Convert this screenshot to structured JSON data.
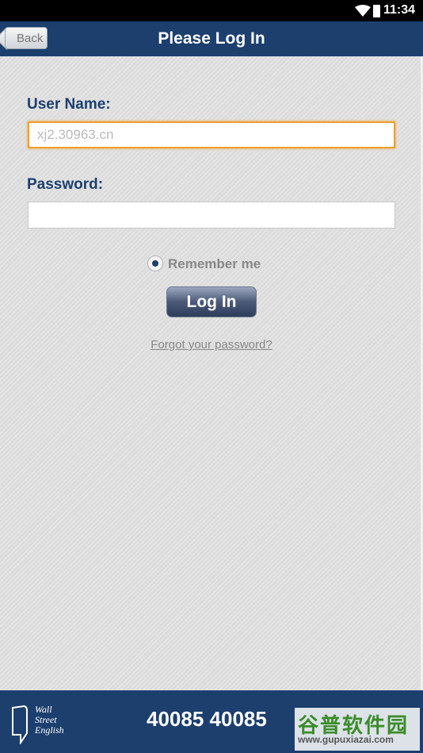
{
  "status_bar": {
    "time": "11:34"
  },
  "app_bar": {
    "back_label": "Back",
    "title": "Please Log In"
  },
  "form": {
    "username_label": "User Name:",
    "username_placeholder": "xj2.30963.cn",
    "username_value": "",
    "password_label": "Password:",
    "password_value": "",
    "remember_label": "Remember me",
    "remember_checked": true,
    "login_label": "Log In",
    "forgot_label": "Forgot your password?"
  },
  "footer": {
    "logo_text": [
      "Wall",
      "Street",
      "English"
    ],
    "phone": "40085 40085",
    "watermark_top": "谷普软件园",
    "watermark_bottom": "www.gupuxiazai.com"
  },
  "colors": {
    "primary": "#1c3f6e",
    "focus": "#f0a030",
    "background": "#dcdcdc"
  }
}
